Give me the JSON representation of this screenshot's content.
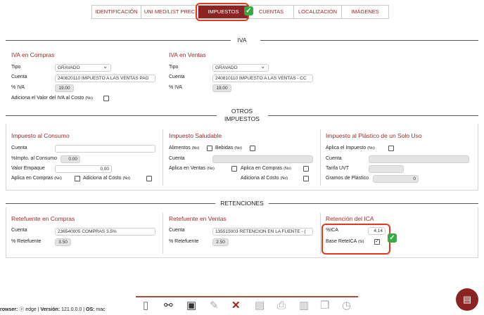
{
  "tabs": [
    "IDENTIFICACIÓN",
    "UNI MED/LIST PREC",
    "IMPUESTOS",
    "CUENTAS",
    "LOCALIZACIÓN",
    "IMÁGENES"
  ],
  "iva": {
    "heading": "IVA",
    "compras": {
      "title": "IVA en Compras",
      "tipo_label": "Tipo",
      "tipo_value": "GRAVADO",
      "cuenta_label": "Cuenta",
      "cuenta_value": "240820110 IMPUESTO A LAS VENTAS PAG",
      "pct_label": "% IVA",
      "pct_value": "19.00",
      "adiciona_label": "Adiciona el Valor del IVA al Costo",
      "adiciona_note": "(No)"
    },
    "ventas": {
      "title": "IVA en Ventas",
      "tipo_label": "Tipo",
      "tipo_value": "GRAVADO",
      "cuenta_label": "Cuenta",
      "cuenta_value": "240810110 IMPUESTO A LAS VENTAS - CC",
      "pct_label": "% IVA",
      "pct_value": "19.00"
    }
  },
  "otros": {
    "heading1": "OTROS",
    "heading2": "IMPUESTOS",
    "consumo": {
      "title": "Impuesto al Consumo",
      "cuenta_label": "Cuenta",
      "pct_label": "%Impto. al Consumo",
      "pct_value": "0.00",
      "empaque_label": "Valor Empaque",
      "empaque_value": "0.00",
      "compras_label": "Aplica en Compras",
      "compras_note": "(No)",
      "costo_label": "Adiciona al Costo",
      "costo_note": "(No)"
    },
    "saludable": {
      "title": "Impuesto Saludable",
      "alimentos_label": "Alimentos",
      "alimentos_note": "(No)",
      "bebidas_label": "Bebidas",
      "bebidas_note": "(No)",
      "cuenta_label": "Cuenta",
      "ventas_label": "Aplica en Ventas",
      "ventas_note": "(No)",
      "compras_label": "Aplica en Compras",
      "compras_note": "(No)",
      "costo_label": "Adiciona al Costo",
      "costo_note": "(No)"
    },
    "plastico": {
      "title": "Impuesto al Plástico de un Solo Uso",
      "aplica_label": "Aplica el Impuesto",
      "aplica_note": "(No)",
      "cuenta_label": "Cuenta",
      "tarifa_label": "Tarifa UVT",
      "gramos_label": "Gramos de Plástico",
      "gramos_value": "0"
    }
  },
  "retenciones": {
    "heading": "RETENCIONES",
    "compras": {
      "title": "Retefuente en Compras",
      "cuenta_label": "Cuenta",
      "cuenta_value": "236540005 COMPRAS 3.5%",
      "pct_label": "% Retefuente",
      "pct_value": "3.50"
    },
    "ventas": {
      "title": "Retefuente en Ventas",
      "cuenta_label": "Cuenta",
      "cuenta_value": "135515003 RETENCION EN LA FUENTE - (",
      "pct_label": "% Retefuente",
      "pct_value": "2.50"
    },
    "ica": {
      "title": "Retención del ICA",
      "pct_label": "%ICA",
      "pct_value": "4.14",
      "base_label": "Base ReteICA",
      "base_note": "(Si)"
    }
  },
  "footer": {
    "browser_label": "rowser:",
    "browser_value": "edge",
    "version_label": "Versión:",
    "version_value": "121.0.0.0",
    "os_label": "OS:",
    "os_value": "mac"
  },
  "colors": {
    "accent": "#8b2323",
    "highlight": "#e2381c",
    "check": "#3aa845"
  }
}
